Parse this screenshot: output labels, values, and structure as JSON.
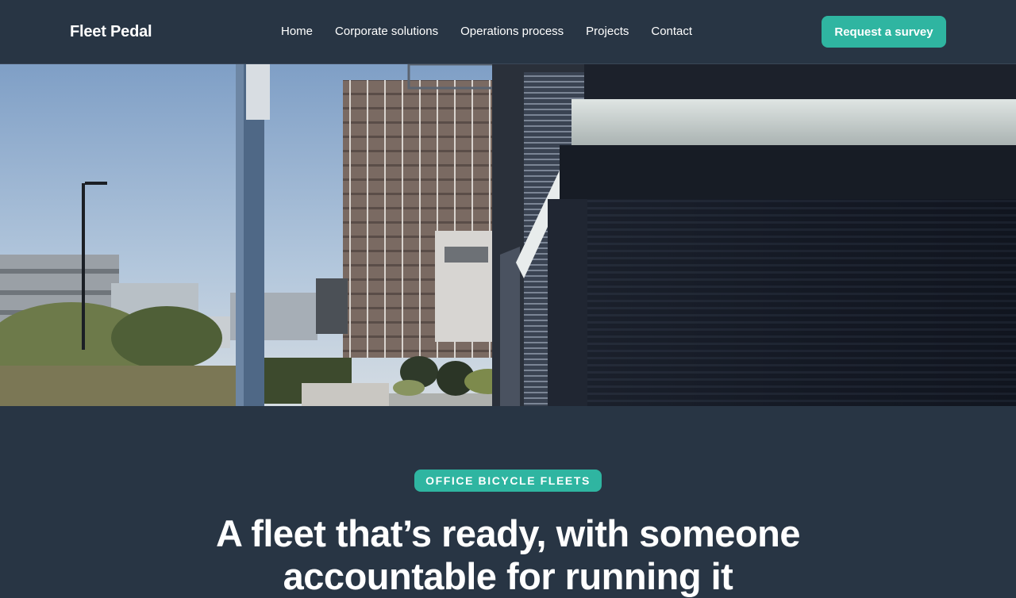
{
  "header": {
    "brand": "Fleet Pedal",
    "nav": [
      {
        "label": "Home"
      },
      {
        "label": "Corporate solutions"
      },
      {
        "label": "Operations process"
      },
      {
        "label": "Projects"
      },
      {
        "label": "Contact"
      }
    ],
    "cta_label": "Request a survey"
  },
  "intro": {
    "eyebrow": "OFFICE BICYCLE FLEETS",
    "headline": "A fleet that’s ready, with someone accountable for running it"
  },
  "colors": {
    "background": "#283544",
    "accent": "#2fb5a1",
    "text": "#ffffff"
  }
}
